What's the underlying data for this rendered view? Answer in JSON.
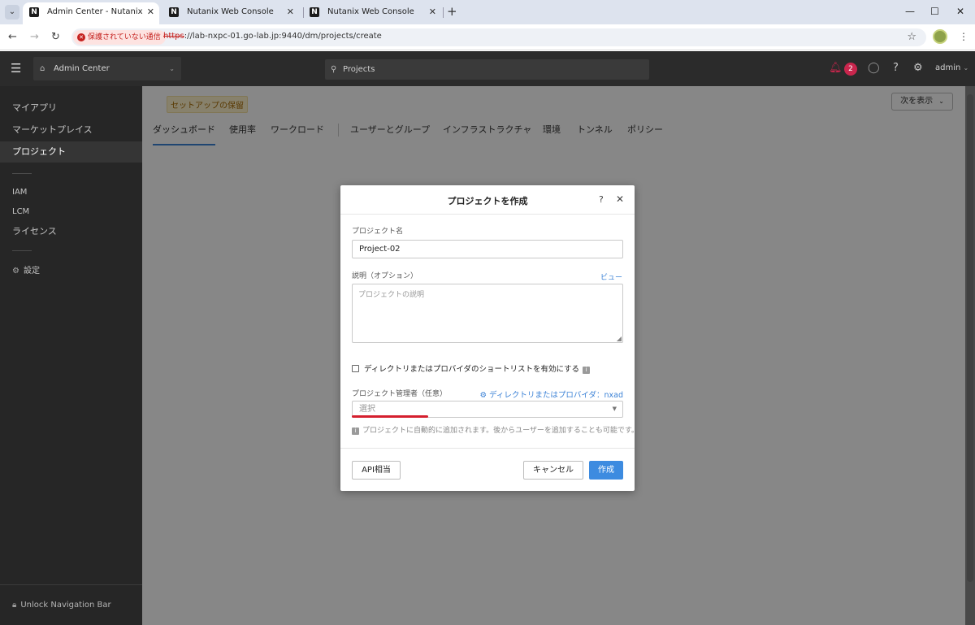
{
  "browser": {
    "tabs": [
      {
        "label": "Admin Center - Nutanix",
        "active": true
      },
      {
        "label": "Nutanix Web Console",
        "active": false
      },
      {
        "label": "Nutanix Web Console",
        "active": false
      }
    ],
    "security_label": "保護されていない通信",
    "url_protocol": "https",
    "url_rest": "://lab-nxpc-01.go-lab.jp:9440/dm/projects/create"
  },
  "header": {
    "app_name": "Admin Center",
    "search_text": "Projects",
    "notification_count": "2",
    "user": "admin"
  },
  "sidebar": {
    "items": [
      {
        "label": "マイアプリ"
      },
      {
        "label": "マーケットプレイス"
      },
      {
        "label": "プロジェクト",
        "active": true
      },
      {
        "label": "IAM"
      },
      {
        "label": "LCM"
      },
      {
        "label": "ライセンス"
      },
      {
        "label": "設定"
      }
    ],
    "unlock_label": "Unlock Navigation Bar"
  },
  "main": {
    "setup_badge": "セットアップの保留",
    "next_button": "次を表示",
    "tabs": [
      {
        "label": "ダッシュボード",
        "active": true
      },
      {
        "label": "使用率"
      },
      {
        "label": "ワークロード"
      },
      {
        "label": "ユーザーとグループ"
      },
      {
        "label": "インフラストラクチャ"
      },
      {
        "label": "環境"
      },
      {
        "label": "トンネル"
      },
      {
        "label": "ポリシー"
      }
    ]
  },
  "modal": {
    "title": "プロジェクトを作成",
    "project_name_label": "プロジェクト名",
    "project_name_value": "Project-02",
    "description_label": "説明（オプション）",
    "preview_link": "ビュー",
    "description_placeholder": "プロジェクトの説明",
    "checkbox_label": "ディレクトリまたはプロバイダのショートリストを有効にする",
    "admin_label": "プロジェクト管理者（任意）",
    "directory_link": "ディレクトリまたはプロバイダ：nxad",
    "select_placeholder": "選択",
    "hint": "プロジェクトに自動的に追加されます。後からユーザーを追加することも可能です。",
    "api_button": "API相当",
    "cancel_button": "キャンセル",
    "create_button": "作成"
  },
  "colors": {
    "accent": "#3d8be0",
    "danger": "#d51f2e",
    "sidebar_bg": "#262626",
    "header_bg": "#2b2b2b"
  }
}
